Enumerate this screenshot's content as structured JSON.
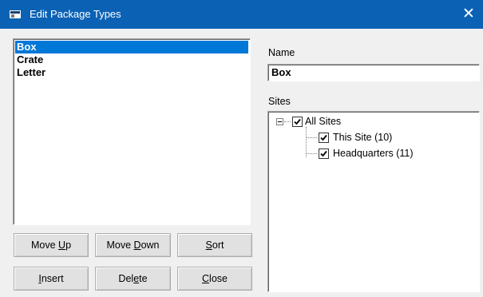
{
  "window": {
    "title": "Edit Package Types",
    "close_glyph": "✕",
    "title_bar_color": "#0b62b5"
  },
  "package_list": {
    "items": [
      {
        "label": "Box",
        "selected": true
      },
      {
        "label": "Crate",
        "selected": false
      },
      {
        "label": "Letter",
        "selected": false
      }
    ],
    "selection_color": "#0078d7"
  },
  "buttons": {
    "move_up": {
      "pre": "Move ",
      "mnemonic": "U",
      "post": "p"
    },
    "move_down": {
      "pre": "Move ",
      "mnemonic": "D",
      "post": "own"
    },
    "sort": {
      "pre": "",
      "mnemonic": "S",
      "post": "ort"
    },
    "insert": {
      "pre": "",
      "mnemonic": "I",
      "post": "nsert"
    },
    "delete": {
      "pre": "Del",
      "mnemonic": "e",
      "post": "te"
    },
    "close": {
      "pre": "",
      "mnemonic": "C",
      "post": "lose"
    }
  },
  "name_section": {
    "label": "Name",
    "value": "Box"
  },
  "sites_section": {
    "label": "Sites",
    "tree": {
      "expander_glyph": "−",
      "root": {
        "label": "All Sites",
        "checked": true
      },
      "children": [
        {
          "label": "This Site (10)",
          "checked": true
        },
        {
          "label": "Headquarters (11)",
          "checked": true
        }
      ]
    }
  }
}
